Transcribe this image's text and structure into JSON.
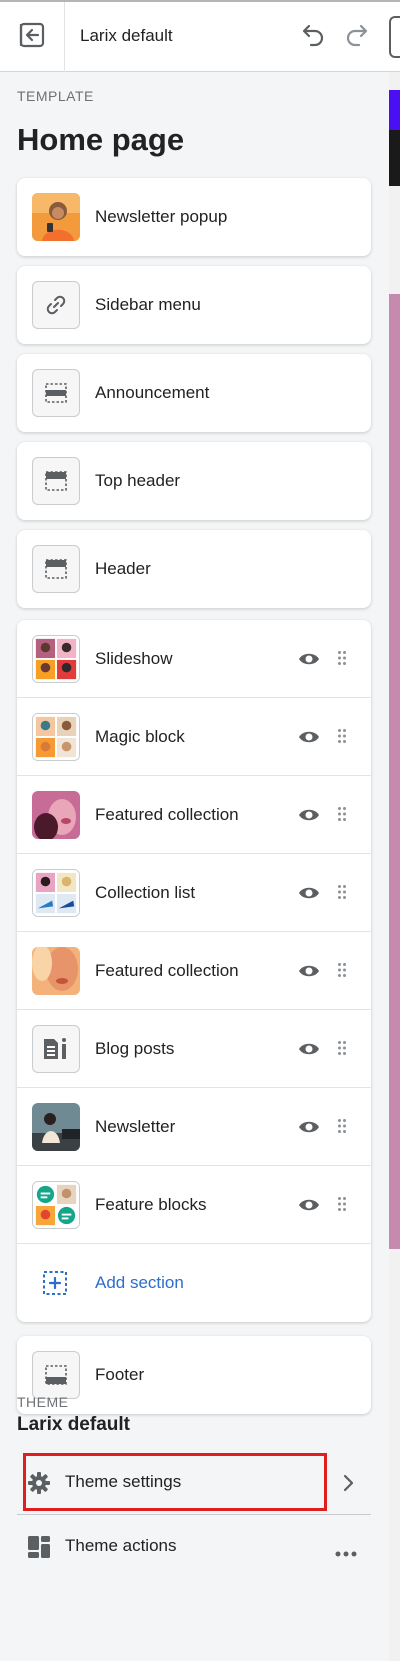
{
  "header": {
    "theme_name": "Larix default",
    "exit_icon": "exit-icon",
    "undo_icon": "undo-icon",
    "redo_icon": "redo-icon"
  },
  "template": {
    "eyebrow": "TEMPLATE",
    "title": "Home page"
  },
  "header_sections": [
    {
      "label": "Newsletter popup",
      "icon": "newsletter-popup-thumbnail"
    },
    {
      "label": "Sidebar menu",
      "icon": "link-icon"
    },
    {
      "label": "Announcement",
      "icon": "announcement-bar-icon"
    },
    {
      "label": "Top header",
      "icon": "header-icon"
    },
    {
      "label": "Header",
      "icon": "header-icon"
    }
  ],
  "sections": [
    {
      "label": "Slideshow",
      "icon": "slideshow-thumbnail"
    },
    {
      "label": "Magic block",
      "icon": "magic-block-thumbnail"
    },
    {
      "label": "Featured collection",
      "icon": "featured-collection-thumbnail"
    },
    {
      "label": "Collection list",
      "icon": "collection-list-thumbnail"
    },
    {
      "label": "Featured collection",
      "icon": "featured-collection-thumbnail"
    },
    {
      "label": "Blog posts",
      "icon": "blog-icon"
    },
    {
      "label": "Newsletter",
      "icon": "newsletter-thumbnail"
    },
    {
      "label": "Feature blocks",
      "icon": "feature-blocks-thumbnail"
    }
  ],
  "add_section": {
    "label": "Add section",
    "icon": "add-section-icon"
  },
  "footer": {
    "label": "Footer",
    "icon": "footer-icon"
  },
  "theme": {
    "eyebrow": "THEME",
    "name": "Larix default",
    "settings_label": "Theme settings",
    "actions_label": "Theme actions"
  },
  "colors": {
    "accent_link": "#2c6ecb",
    "highlight": "#e01e1e",
    "preview_purple": "#4a0ff2",
    "preview_pink": "#c68aae"
  }
}
